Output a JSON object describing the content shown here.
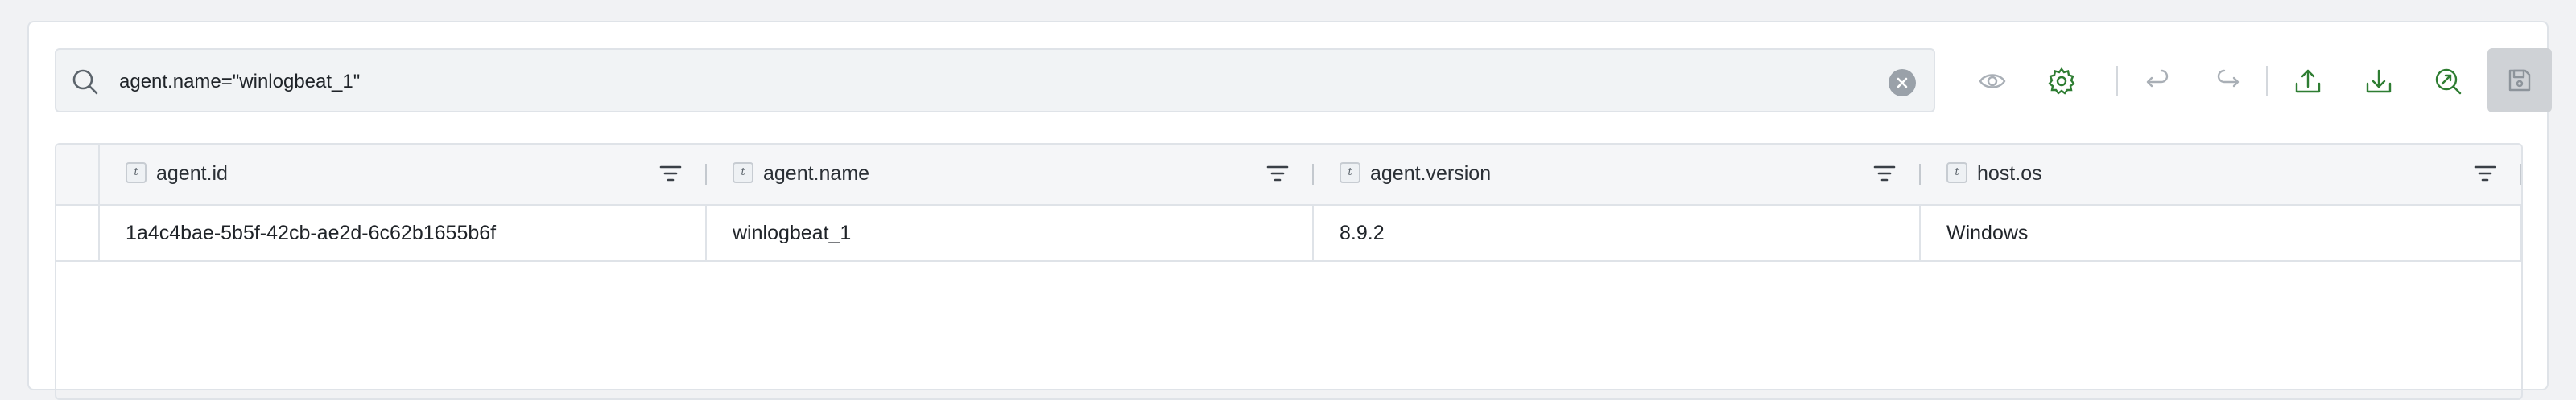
{
  "search": {
    "query": "agent.name=\"winlogbeat_1\""
  },
  "toolbar": {
    "icons": [
      "eye-icon",
      "gear-icon",
      "undo-icon",
      "redo-icon",
      "upload-icon",
      "download-icon",
      "search-link-icon",
      "save-icon"
    ],
    "accent_color": "#2e7d32",
    "muted_color": "#9aa1a9"
  },
  "table": {
    "columns": [
      {
        "type": "t",
        "label": "agent.id"
      },
      {
        "type": "t",
        "label": "agent.name"
      },
      {
        "type": "t",
        "label": "agent.version"
      },
      {
        "type": "t",
        "label": "host.os"
      }
    ],
    "rows": [
      [
        "1a4c4bae-5b5f-42cb-ae2d-6c62b1655b6f",
        "winlogbeat_1",
        "8.9.2",
        "Windows"
      ]
    ]
  }
}
